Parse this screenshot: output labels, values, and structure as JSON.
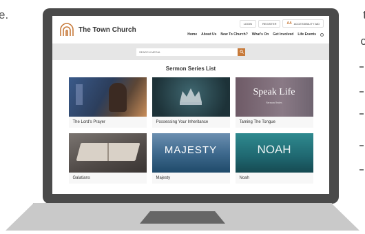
{
  "page_edges": {
    "left_text": "e.",
    "right_text_1": "t",
    "right_text_2": "c"
  },
  "site": {
    "brand": "The Town Church",
    "util_links": [
      "LOGIN",
      "REGISTER"
    ],
    "accessibility": {
      "icon": "AA",
      "label": "ACCESSIBILITY AID"
    },
    "nav": [
      "Home",
      "About Us",
      "New To Church?",
      "What's On",
      "Get Involved",
      "Life Events"
    ],
    "search": {
      "placeholder": "SEARCH MEDIA",
      "button_icon": "search-icon"
    },
    "section_title": "Sermon Series List",
    "series": [
      {
        "title": "The Lord's Prayer",
        "thumb_text": ""
      },
      {
        "title": "Possessing Your Inheritance",
        "thumb_text": ""
      },
      {
        "title": "Taming The Tongue",
        "thumb_text": "Speak Life",
        "thumb_sub": "Sermon Series"
      },
      {
        "title": "Galatians",
        "thumb_text": ""
      },
      {
        "title": "Majesty",
        "thumb_text": "MAJESTY"
      },
      {
        "title": "Noah",
        "thumb_text": "NOAH"
      }
    ],
    "accent_color": "#c77a3a"
  }
}
